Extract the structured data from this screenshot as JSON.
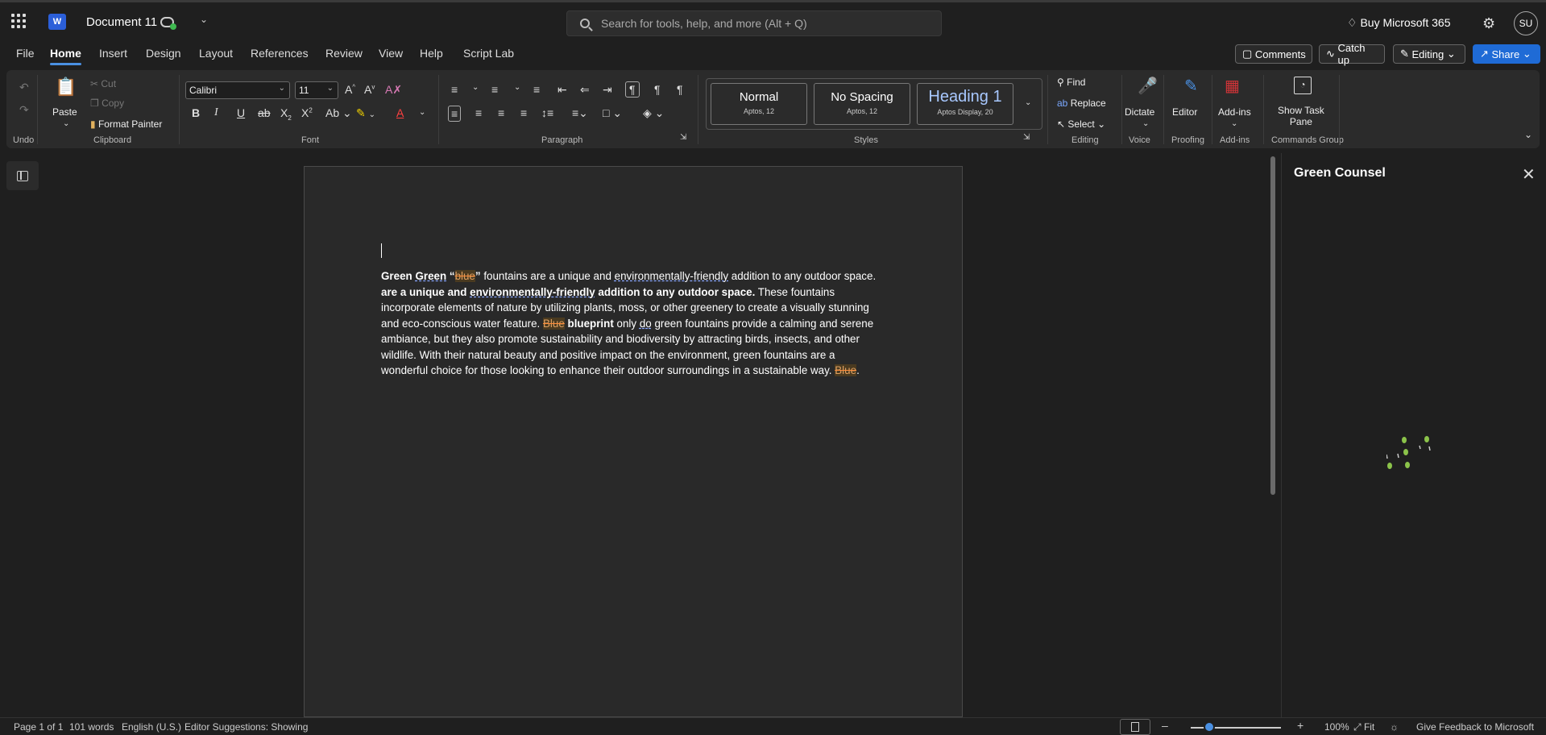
{
  "app": {
    "doc_title": "Document 11",
    "search_placeholder": "Search for tools, help, and more (Alt + Q)",
    "buy_label": "Buy Microsoft 365",
    "avatar_initials": "SU",
    "logo_letter": "W"
  },
  "menu": {
    "file": "File",
    "home": "Home",
    "insert": "Insert",
    "design": "Design",
    "layout": "Layout",
    "references": "References",
    "review": "Review",
    "view": "View",
    "help": "Help",
    "scriptlab": "Script Lab"
  },
  "top_actions": {
    "comments": "Comments",
    "catchup": "Catch up",
    "editing": "Editing",
    "share": "Share"
  },
  "ribbon": {
    "undo_group": "Undo",
    "clipboard": {
      "paste": "Paste",
      "cut": "Cut",
      "copy": "Copy",
      "format_painter": "Format Painter",
      "label": "Clipboard"
    },
    "font": {
      "name": "Calibri",
      "size": "11",
      "label": "Font"
    },
    "paragraph": {
      "label": "Paragraph"
    },
    "styles": {
      "label": "Styles",
      "items": [
        {
          "name": "Normal",
          "sub": "Aptos, 12"
        },
        {
          "name": "No Spacing",
          "sub": "Aptos, 12"
        },
        {
          "name": "Heading 1",
          "sub": "Aptos Display, 20"
        }
      ]
    },
    "editing": {
      "find": "Find",
      "replace": "Replace",
      "select": "Select",
      "label": "Editing"
    },
    "voice": {
      "dictate": "Dictate",
      "label": "Voice"
    },
    "proofing": {
      "editor": "Editor",
      "label": "Proofing"
    },
    "addins": {
      "addins": "Add-ins",
      "label": "Add-ins"
    },
    "commands": {
      "show_task": "Show Task",
      "pane": "Pane",
      "label": "Commands Group"
    }
  },
  "document": {
    "s1_bold": "Green",
    "s1_u": "Green",
    "s1_q1": " “",
    "s1_strike": "blue",
    "s1_q2": "”",
    "s1_rest": " fountains are a unique and ",
    "s1_u2": "environmentally-friendly",
    "s1_rest2": " addition to any outdoor space.",
    "s2_bold_a": "are a unique and ",
    "s2_bold_u": "environmentally-friendly",
    "s2_bold_b": " addition to any outdoor space.",
    "s2_rest": " These fountains incorporate elements of nature by utilizing plants, moss, or other greenery to create a visually stunning and eco-conscious water feature. ",
    "s3_strike": "Blue",
    "s3_bold": " blueprint",
    "s3_rest": " only ",
    "s3_u": "do",
    "s3_rest2": " green fountains provide a calming and serene ambiance, but they also promote sustainability and biodiversity by attracting birds, insects, and other wildlife. With their natural beauty and positive impact on the environment, green fountains are a wonderful choice for those looking to enhance their outdoor surroundings in a sustainable way. ",
    "s4_strike": "Blue",
    "s4_end": "."
  },
  "task_pane": {
    "title": "Green Counsel"
  },
  "status": {
    "page": "Page 1 of 1",
    "words": "101 words",
    "language": "English (U.S.)",
    "editor": "Editor Suggestions: Showing",
    "zoom": "100%",
    "fit": "Fit",
    "feedback": "Give Feedback to Microsoft",
    "zoom_value": 100
  }
}
